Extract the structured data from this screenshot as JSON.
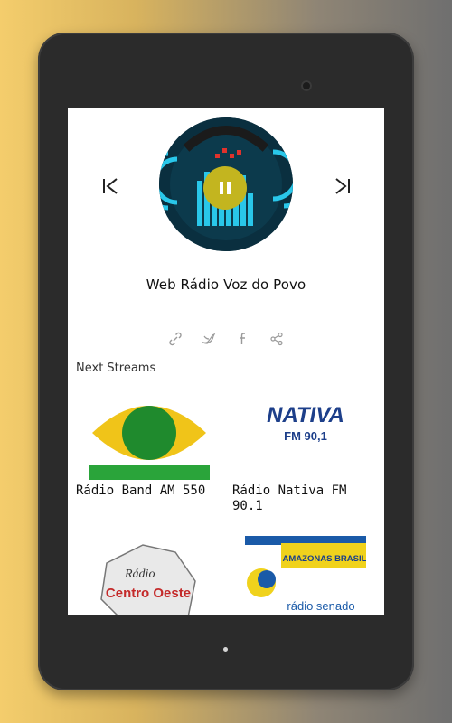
{
  "player": {
    "station_title": "Web Rádio Voz do Povo",
    "icons": {
      "prev": "skip-previous-icon",
      "next": "skip-next-icon",
      "pause": "pause-icon",
      "share": [
        "link-icon",
        "twitter-icon",
        "facebook-icon",
        "share-icon"
      ]
    },
    "accent": "#c3b51f"
  },
  "next_streams": {
    "heading": "Next Streams",
    "items": [
      {
        "label": "Rádio Band AM 550",
        "logo_text": ""
      },
      {
        "label": "Rádio Nativa FM 90.1",
        "logo_text": "NATIVA",
        "logo_sub": "FM 90,1"
      },
      {
        "label": "",
        "logo_text": "Rádio",
        "logo_sub": "Centro Oeste"
      },
      {
        "label": "",
        "logo_text": "AMAZONAS BRASIL",
        "logo_sub": "rádio senado"
      }
    ]
  }
}
